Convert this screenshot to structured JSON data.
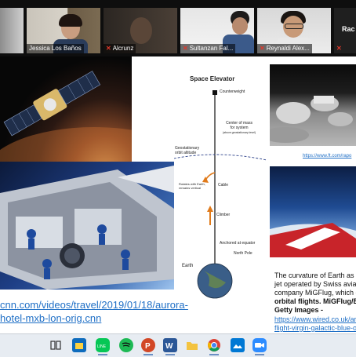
{
  "participants": [
    {
      "name": "Jessica Los Baños"
    },
    {
      "name": "Alcrunz"
    },
    {
      "name": "Sultanzan Fal..."
    },
    {
      "name": "Reynaldi Alex..."
    },
    {
      "name": "Rac"
    }
  ],
  "slide": {
    "elevator": {
      "title": "Space Elevator",
      "labels": {
        "counterweight": "Counterweight",
        "center_of_mass": "Center of mass",
        "center_of_mass_2": "for system",
        "center_of_mass_3": "(above geostationary level)",
        "geo_orbit": "Geostationary",
        "geo_orbit_2": "orbit altitude",
        "rotates": "Rotates with Earth,",
        "rotates_2": "remains vertical",
        "cable": "Cable",
        "climber": "Climber",
        "anchored": "Anchored at equator",
        "north_pole": "North Pole",
        "earth": "Earth"
      }
    },
    "left_link": {
      "line1": "cnn.com/videos/travel/2019/01/18/aurora-",
      "line2": "hotel-mxb-lon-orig.cnn"
    },
    "top_right_link": "https://www.ft.com/rapo",
    "caption": {
      "line1": "The curvature of Earth as s",
      "line2": "jet operated by Swiss aviat",
      "line3": "company MiGFlug, which c",
      "line4": "orbital flights. MiGFlug/B",
      "line5": "Getty Images -"
    },
    "bottom_right_link": {
      "line1": "https://www.wired.co.uk/art",
      "line2": "flight-virgin-galactic-blue-o"
    }
  },
  "taskbar": {
    "icons": [
      "task-view-icon",
      "store-icon",
      "line-icon",
      "spotify-icon",
      "powerpoint-icon",
      "word-icon",
      "file-explorer-icon",
      "chrome-icon",
      "photos-icon",
      "zoom-icon"
    ]
  }
}
